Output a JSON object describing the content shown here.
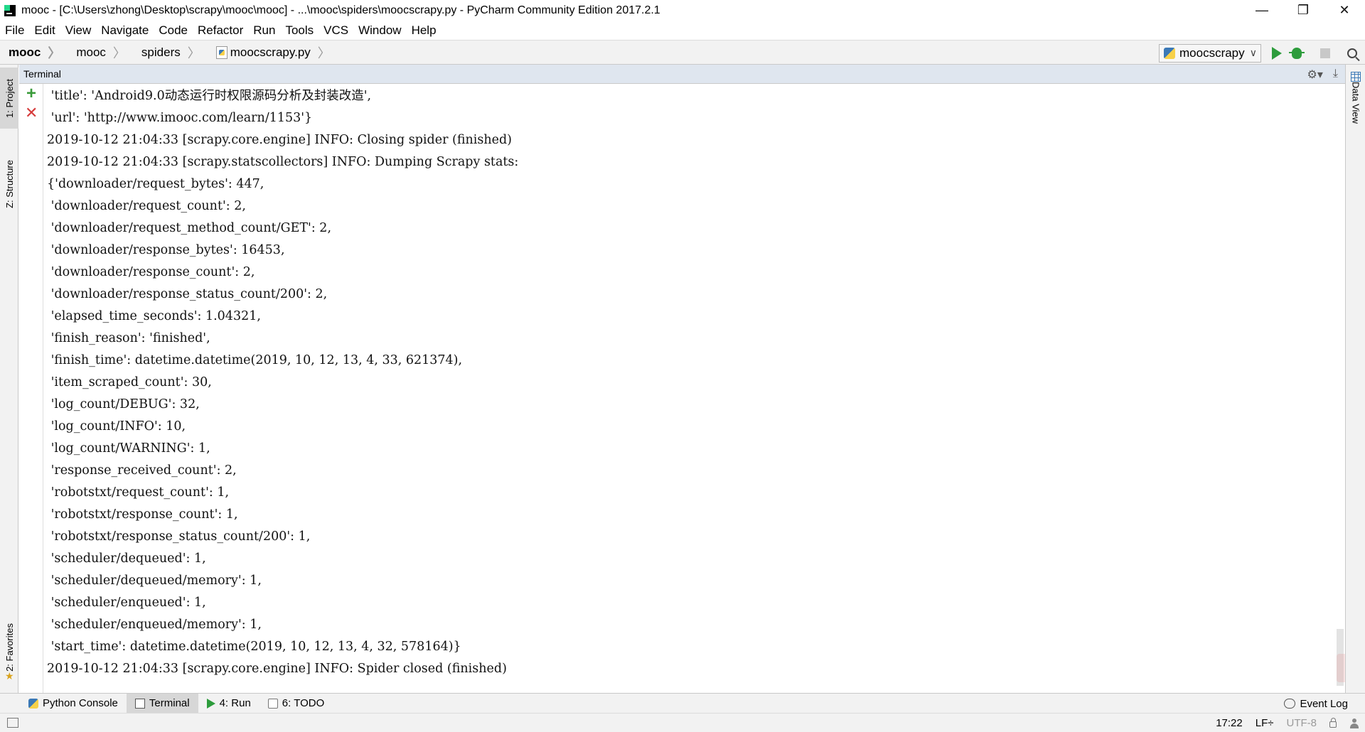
{
  "window": {
    "title": "mooc - [C:\\Users\\zhong\\Desktop\\scrapy\\mooc\\mooc] - ...\\mooc\\spiders\\moocscrapy.py - PyCharm Community Edition 2017.2.1",
    "controls": {
      "minimize": "—",
      "restore": "❐",
      "close": "✕"
    }
  },
  "menu": {
    "items": [
      "File",
      "Edit",
      "View",
      "Navigate",
      "Code",
      "Refactor",
      "Run",
      "Tools",
      "VCS",
      "Window",
      "Help"
    ]
  },
  "navbar": {
    "breadcrumbs": [
      "mooc",
      "mooc",
      "spiders",
      "moocscrapy.py"
    ],
    "run_config": "moocscrapy"
  },
  "left_tools": {
    "project": "1: Project",
    "structure": "Z: Structure",
    "favorites": "2: Favorites"
  },
  "right_tools": {
    "data_view": "Data View"
  },
  "terminal": {
    "title": "Terminal",
    "lines": [
      " 'title': 'Android9.0动态运行时权限源码分析及封装改造',",
      " 'url': 'http://www.imooc.com/learn/1153'}",
      "2019-10-12 21:04:33 [scrapy.core.engine] INFO: Closing spider (finished)",
      "2019-10-12 21:04:33 [scrapy.statscollectors] INFO: Dumping Scrapy stats:",
      "{'downloader/request_bytes': 447,",
      " 'downloader/request_count': 2,",
      " 'downloader/request_method_count/GET': 2,",
      " 'downloader/response_bytes': 16453,",
      " 'downloader/response_count': 2,",
      " 'downloader/response_status_count/200': 2,",
      " 'elapsed_time_seconds': 1.04321,",
      " 'finish_reason': 'finished',",
      " 'finish_time': datetime.datetime(2019, 10, 12, 13, 4, 33, 621374),",
      " 'item_scraped_count': 30,",
      " 'log_count/DEBUG': 32,",
      " 'log_count/INFO': 10,",
      " 'log_count/WARNING': 1,",
      " 'response_received_count': 2,",
      " 'robotstxt/request_count': 1,",
      " 'robotstxt/response_count': 1,",
      " 'robotstxt/response_status_count/200': 1,",
      " 'scheduler/dequeued': 1,",
      " 'scheduler/dequeued/memory': 1,",
      " 'scheduler/enqueued': 1,",
      " 'scheduler/enqueued/memory': 1,",
      " 'start_time': datetime.datetime(2019, 10, 12, 13, 4, 32, 578164)}",
      "2019-10-12 21:04:33 [scrapy.core.engine] INFO: Spider closed (finished)"
    ]
  },
  "bottom_tabs": {
    "python_console": "Python Console",
    "terminal": "Terminal",
    "run": "4: Run",
    "todo": "6: TODO",
    "event_log": "Event Log"
  },
  "status": {
    "position": "17:22",
    "line_separator": "LF÷",
    "encoding": "UTF-8"
  },
  "icons": {
    "add": "+",
    "close": "✕",
    "gear": "⚙▾",
    "hide": "⤓"
  }
}
